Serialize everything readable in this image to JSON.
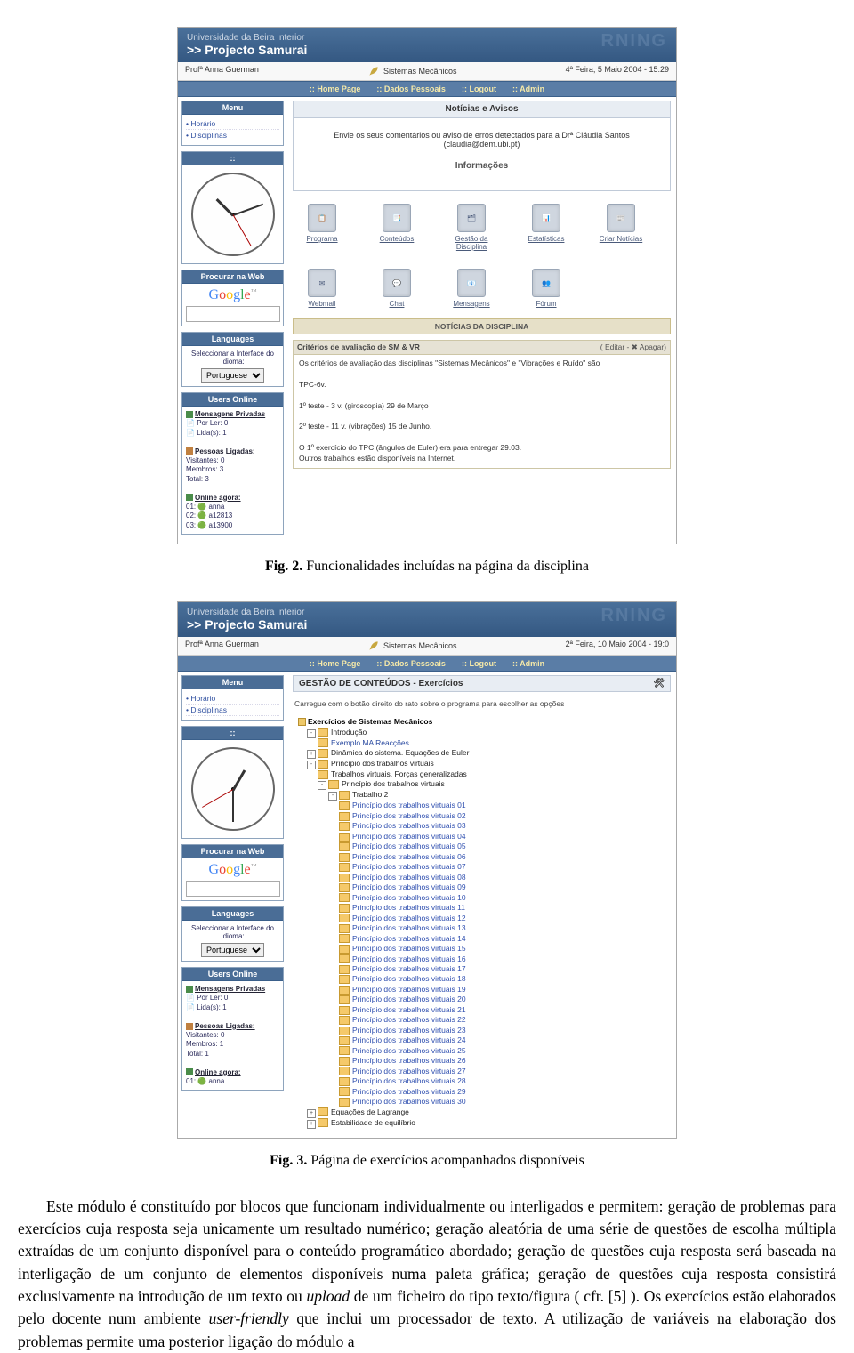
{
  "fig2": {
    "header_uni": "Universidade da Beira Interior",
    "header_proj": ">> Projecto Samurai",
    "ghost": "RNING",
    "info_left": "Profª Anna Guerman",
    "info_mid": "Sistemas Mecânicos",
    "info_right": "4ª Feira, 5 Maio 2004 - 15:29",
    "nav": {
      "home": "Home Page",
      "dados": "Dados Pessoais",
      "logout": "Logout",
      "admin": "Admin"
    },
    "side": {
      "menu_h": "Menu",
      "menu_items": [
        "Horário",
        "Disciplinas"
      ],
      "clock_h": "",
      "search_h": "Procurar na Web",
      "lang_h": "Languages",
      "lang_label": "Seleccionar a Interface do Idioma:",
      "lang_val": "Portuguese",
      "users_h": "Users Online",
      "users": {
        "msg_h": "Mensagens Privadas",
        "porler": "Por Ler: 0",
        "lidas": "Lida(s): 1",
        "pess_h": "Pessoas Ligadas:",
        "vis": "Visitantes: 0",
        "mem": "Membros: 3",
        "tot": "Total: 3",
        "now_h": "Online agora:",
        "now": [
          "01: 🟢 anna",
          "02: 🟢 a12813",
          "03: 🟢 a13900"
        ]
      }
    },
    "main": {
      "title": "Notícias e Avisos",
      "notice": "Envie os seus comentários ou aviso de erros detectados para a Drª Cláudia Santos (claudia@dem.ubi.pt)",
      "info_h": "Informações",
      "icons": [
        "Programa",
        "Conteúdos",
        "Gestão da Disciplina",
        "Estatísticas",
        "Criar Notícias",
        "Webmail",
        "Chat",
        "Mensagens",
        "Fórum"
      ],
      "newsbar": "NOTÍCIAS DA DISCIPLINA",
      "news_title": "Critérios de avaliação de SM & VR",
      "news_actions": "(  Editar - ✖ Apagar)",
      "news_body": [
        "Os critérios de avaliação das disciplinas \"Sistemas Mecânicos\" e \"Vibrações e Ruído\" são",
        "TPC-6v.",
        "1º teste - 3 v. (giroscopia)    29 de Março",
        "2º teste - 11 v. (vibrações)    15 de Junho.",
        "O 1º exercício do TPC (ângulos de Euler) era para entregar 29.03.",
        "Outros trabalhos  estão disponíveis na Internet."
      ]
    },
    "caption_label": "Fig. 2.",
    "caption": "Funcionalidades incluídas na página da disciplina"
  },
  "fig3": {
    "info_right": "2ª Feira, 10 Maio 2004 - 19:0",
    "main_title": "GESTÃO DE CONTEÚDOS - Exercícios",
    "hint": "Carregue com o botão direito do rato sobre o programa para escolher as opções",
    "root": "Exercícios de Sistemas Mecânicos",
    "lvl1": [
      "Introdução",
      "Exemplo MA Reacções",
      "Dinâmica do sistema. Equações de Euler",
      "Princípio dos trabalhos virtuais"
    ],
    "lvl2": [
      "Trabalhos virtuais. Forças generalizadas",
      "Princípio dos trabalhos virtuais"
    ],
    "lvl3": "Trabalho 2",
    "leaf_prefix": "Princípio dos trabalhos virtuais ",
    "leaf_count": 30,
    "tail": [
      "Equações de Lagrange",
      "Estabilidade de equilíbrio"
    ],
    "users": {
      "msg_h": "Mensagens Privadas",
      "porler": "Por Ler: 0",
      "lidas": "Lida(s): 1",
      "pess_h": "Pessoas Ligadas:",
      "vis": "Visitantes: 0",
      "mem": "Membros: 1",
      "tot": "Total: 1",
      "now_h": "Online agora:",
      "now": [
        "01: 🟢 anna"
      ]
    },
    "caption_label": "Fig. 3.",
    "caption": "Página de exercícios acompanhados disponíveis"
  },
  "paragraph": "Este módulo é constituído por blocos que funcionam individualmente ou interligados e permitem: geração de problemas para exercícios cuja resposta seja unicamente um resultado numérico; geração aleatória de uma série de questões de escolha múltipla extraídas de um conjunto disponível para o conteúdo programático abordado; geração de questões cuja resposta será baseada na interligação de um conjunto de elementos disponíveis numa paleta gráfica; geração de questões cuja resposta consistirá exclusivamente na introdução de um texto ou upload de um ficheiro do tipo texto/figura ( cfr. [5] ). Os exercícios estão elaborados pelo docente num ambiente user-friendly que inclui um processador de texto. A utilização de variáveis na elaboração dos problemas permite uma posterior ligação do módulo a",
  "italic_words": [
    "upload",
    "user-friendly"
  ]
}
